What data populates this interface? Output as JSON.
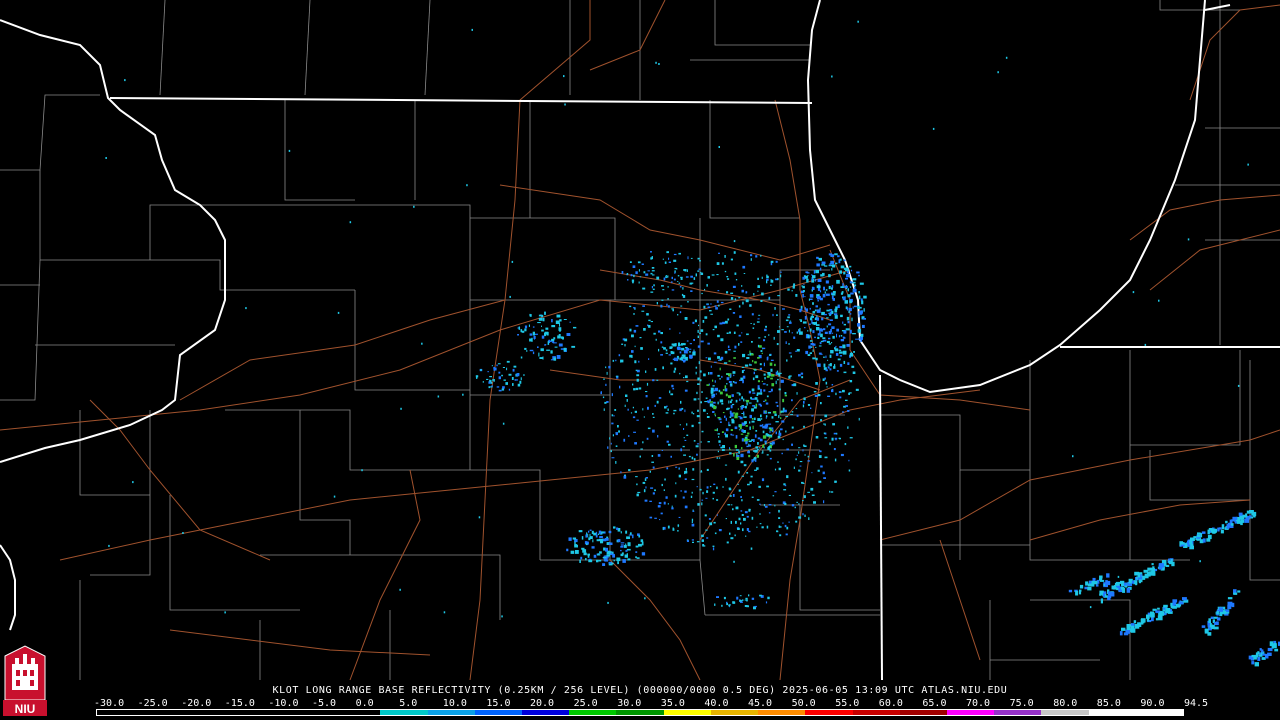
{
  "caption": "KLOT LONG RANGE BASE REFLECTIVITY (0.25KM / 256 LEVEL) (000000/0000 0.5 DEG) 2025-06-05 13:09 UTC  ATLAS.NIU.EDU",
  "scale": {
    "labels": [
      "-30.0",
      "-25.0",
      "-20.0",
      "-15.0",
      "-10.0",
      "-5.0",
      "0.0",
      "5.0",
      "10.0",
      "15.0",
      "20.0",
      "25.0",
      "30.0",
      "35.0",
      "40.0",
      "45.0",
      "50.0",
      "55.0",
      "60.0",
      "65.0",
      "70.0",
      "75.0",
      "80.0",
      "85.0",
      "90.0",
      "94.5"
    ],
    "colors": [
      "#000000",
      "#000000",
      "#000000",
      "#000000",
      "#000000",
      "#000000",
      "#00c8c8",
      "#0aa0e6",
      "#0064ff",
      "#0000dc",
      "#00c800",
      "#009600",
      "#ffff00",
      "#e6b400",
      "#ff8c00",
      "#ff0000",
      "#c80000",
      "#a00000",
      "#ff00ff",
      "#9632c8",
      "#c8c8c8",
      "#ffffff",
      "#ffffff"
    ]
  },
  "logo": {
    "text": "NIU",
    "colors": {
      "red": "#c8102e",
      "white": "#ffffff"
    }
  },
  "map_colors": {
    "state_border": "#ffffff",
    "county_line": "#8a8a8a",
    "highway": "#a0522d",
    "echo_light": "#1ec8e6",
    "echo_medium": "#1e78ff",
    "echo_strong": "#3cc83c"
  }
}
